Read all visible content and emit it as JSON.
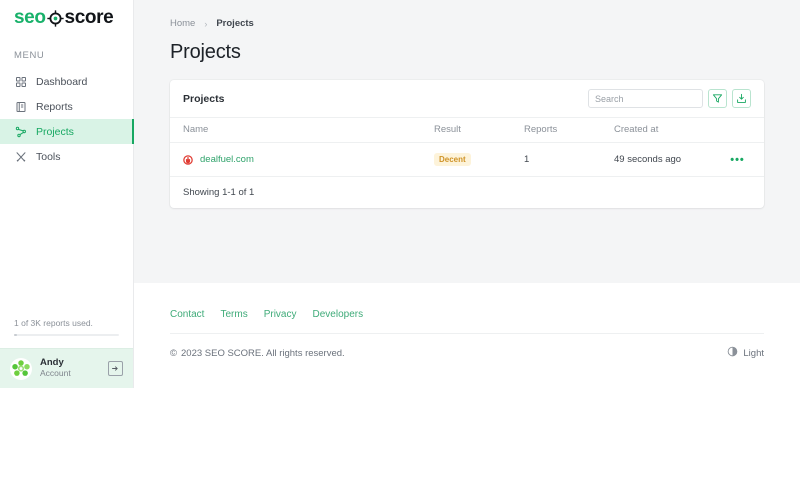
{
  "brand": {
    "logo_seo": "seo",
    "logo_score": "score",
    "logo_mark_icon": "target-crosshair-icon",
    "accent_color": "#17a862",
    "logo_green": "#18b16a",
    "logo_dark": "#111418"
  },
  "sidebar": {
    "menu_label": "MENU",
    "items": [
      {
        "label": "Dashboard",
        "icon": "grid-icon",
        "active": false
      },
      {
        "label": "Reports",
        "icon": "document-icon",
        "active": false
      },
      {
        "label": "Projects",
        "icon": "network-share-icon",
        "active": true
      },
      {
        "label": "Tools",
        "icon": "tools-icon",
        "active": false
      }
    ],
    "usage": {
      "text": "1 of 3K reports used.",
      "percent": 3
    },
    "account": {
      "name": "Andy",
      "subtitle": "Account",
      "avatar_icon": "identicon-avatar",
      "logout_icon": "logout-icon"
    }
  },
  "breadcrumb": {
    "home": "Home",
    "separator": "›",
    "current": "Projects"
  },
  "page": {
    "title": "Projects"
  },
  "card": {
    "title": "Projects",
    "search": {
      "placeholder": "Search",
      "value": ""
    },
    "filter_icon": "filter-funnel-icon",
    "export_icon": "download-icon",
    "columns": [
      "Name",
      "Result",
      "Reports",
      "Created at"
    ],
    "rows": [
      {
        "favicon": "site-favicon-red",
        "name": "dealfuel.com",
        "result": "Decent",
        "result_bg": "#fdf3da",
        "result_color": "#cf9327",
        "reports": "1",
        "created_at": "49 seconds ago",
        "actions_icon": "ellipsis-menu-icon"
      }
    ],
    "footer_text": "Showing 1-1 of 1"
  },
  "footer": {
    "links": [
      "Contact",
      "Terms",
      "Privacy",
      "Developers"
    ],
    "copyright_mark": "©",
    "copyright": "2023 SEO SCORE. All rights reserved.",
    "theme": {
      "label": "Light",
      "icon": "contrast-half-circle-icon"
    }
  }
}
